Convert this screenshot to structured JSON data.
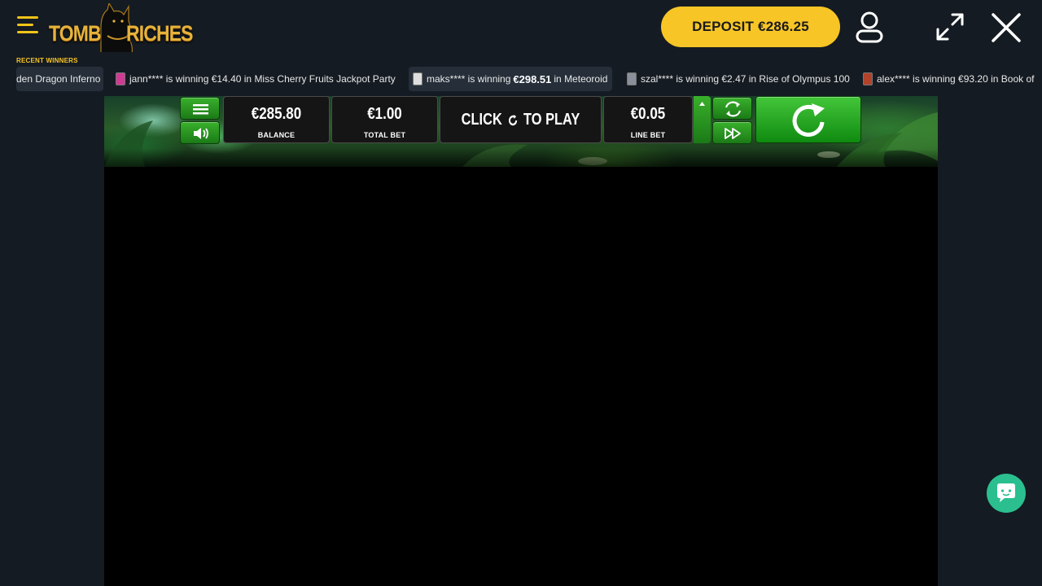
{
  "header": {
    "logo_left": "TOMB",
    "logo_right": "RICHES",
    "deposit_label": "DEPOSIT €286.25"
  },
  "winners": {
    "label": "RECENT WINNERS",
    "items": [
      {
        "text_pre": "den Dragon Inferno",
        "amount": "",
        "text_post": ""
      },
      {
        "text_pre": "jann**** is winning €14.40 in Miss Cherry Fruits Jackpot Party",
        "amount": "",
        "text_post": ""
      },
      {
        "text_pre": "maks**** is winning",
        "amount": "€298.51",
        "text_post": "in Meteoroid"
      },
      {
        "text_pre": "szal**** is winning €2.47 in Rise of Olympus 100",
        "amount": "",
        "text_post": ""
      },
      {
        "text_pre": "alex**** is winning €93.20 in Book of",
        "amount": "",
        "text_post": ""
      }
    ]
  },
  "game": {
    "balance_value": "€285.80",
    "balance_label": "BALANCE",
    "total_bet_value": "€1.00",
    "total_bet_label": "TOTAL BET",
    "play_left": "CLICK",
    "play_right": "TO PLAY",
    "line_bet_value": "€0.05",
    "line_bet_label": "LINE BET"
  },
  "icons": {
    "menu": "hamburger-menu-icon",
    "user": "user-icon",
    "fullscreen": "expand-icon",
    "close": "close-icon",
    "chat": "chat-icon"
  },
  "colors": {
    "background": "#151b22",
    "accent": "#f7c526",
    "game_green": "#1b7a17",
    "chat": "#2bbf8f"
  }
}
